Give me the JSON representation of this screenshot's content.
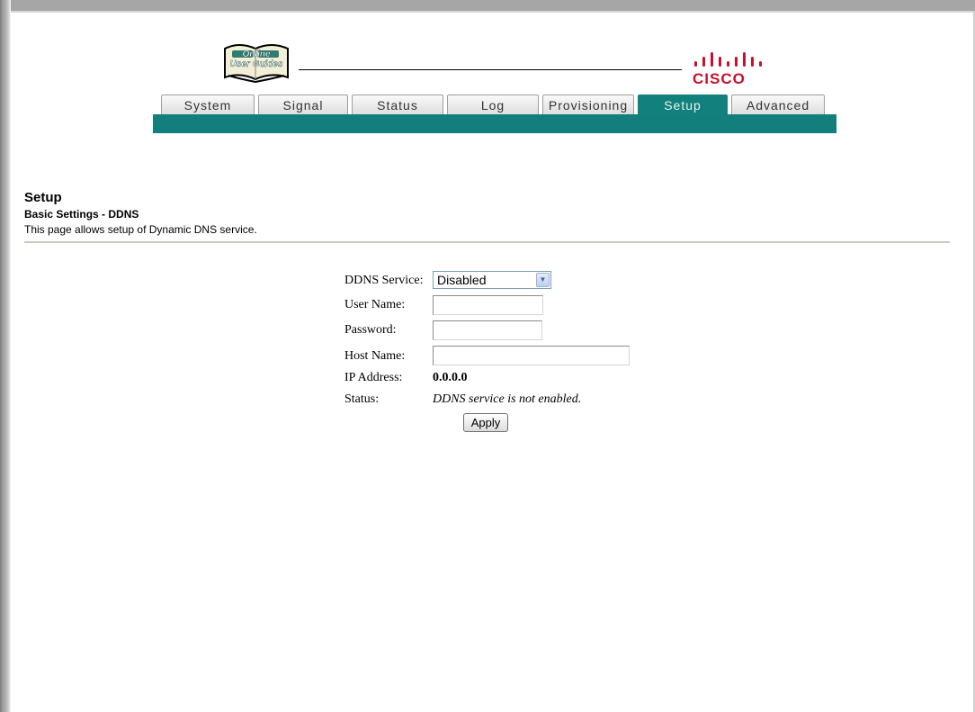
{
  "logo": {
    "line1": "Online",
    "line2": "User Guides"
  },
  "brand": {
    "name": "CISCO",
    "color": "#c8102e"
  },
  "accent_color": "#137f7c",
  "tabs": [
    {
      "label": "System",
      "active": false
    },
    {
      "label": "Signal",
      "active": false
    },
    {
      "label": "Status",
      "active": false
    },
    {
      "label": "Log",
      "active": false
    },
    {
      "label": "Provisioning",
      "active": false
    },
    {
      "label": "Setup",
      "active": true
    },
    {
      "label": "Advanced",
      "active": false
    }
  ],
  "page": {
    "title": "Setup",
    "subtitle": "Basic Settings - DDNS",
    "description": "This page allows setup of Dynamic DNS service."
  },
  "form": {
    "ddns_service": {
      "label": "DDNS Service:",
      "selected": "Disabled"
    },
    "user_name": {
      "label": "User Name:",
      "value": ""
    },
    "password": {
      "label": "Password:",
      "value": ""
    },
    "host_name": {
      "label": "Host Name:",
      "value": ""
    },
    "ip_address": {
      "label": "IP Address:",
      "value": "0.0.0.0"
    },
    "status": {
      "label": "Status:",
      "value": "DDNS service is not enabled."
    },
    "apply_label": "Apply"
  }
}
